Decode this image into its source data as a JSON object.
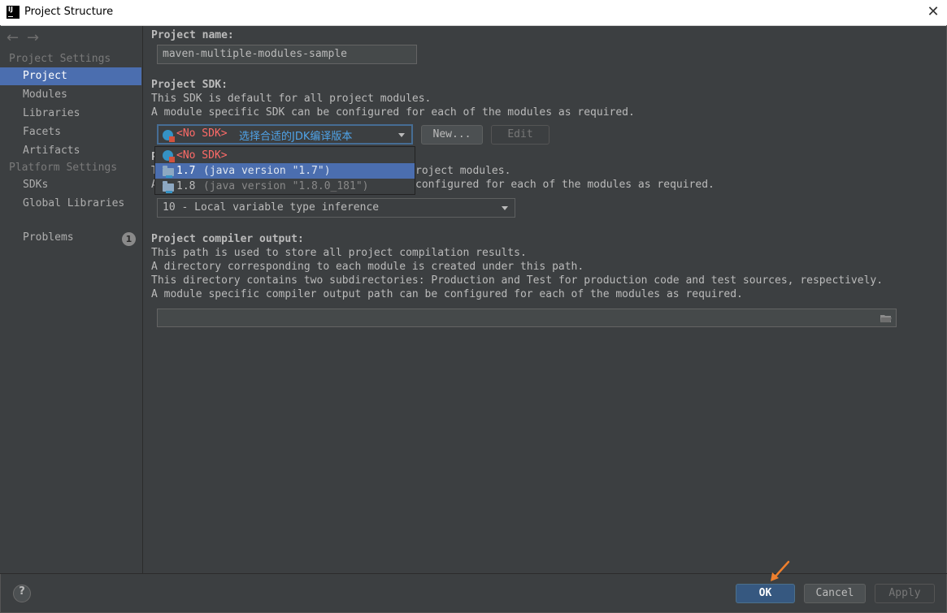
{
  "window": {
    "title": "Project Structure",
    "close_glyph": "✕"
  },
  "toolbar": {
    "back_glyph": "←",
    "forward_glyph": "→"
  },
  "sidebar": {
    "project_settings_title": "Project Settings",
    "project_items": [
      "Project",
      "Modules",
      "Libraries",
      "Facets",
      "Artifacts"
    ],
    "platform_settings_title": "Platform Settings",
    "platform_items": [
      "SDKs",
      "Global Libraries"
    ],
    "problems_label": "Problems",
    "problems_count": "1",
    "selected": "Project"
  },
  "project_name": {
    "label": "Project name:",
    "value": "maven-multiple-modules-sample"
  },
  "project_sdk": {
    "label": "Project SDK:",
    "desc1": "This SDK is default for all project modules.",
    "desc2": "A module specific SDK can be configured for each of the modules as required.",
    "selected_value": "<No SDK>",
    "annotation": "选择合适的JDK编译版本",
    "new_button": "New...",
    "edit_button": "Edit",
    "options": [
      {
        "name": "<No SDK>",
        "detail": ""
      },
      {
        "name": "1.7",
        "detail": "(java version \"1.7\")"
      },
      {
        "name": "1.8",
        "detail": "(java version \"1.8.0_181\")"
      }
    ],
    "highlighted_option": "1.7"
  },
  "project_language_level": {
    "label_partial": "P",
    "desc1_partial": "T",
    "desc1_tail": "roject modules.",
    "desc2_partial": "A",
    "desc2_tail": "configured for each of the modules as required.",
    "value": "10 - Local variable type inference"
  },
  "compiler_output": {
    "label": "Project compiler output:",
    "desc1": "This path is used to store all project compilation results.",
    "desc2": "A directory corresponding to each module is created under this path.",
    "desc3": "This directory contains two subdirectories: Production and Test for production code and test sources, respectively.",
    "desc4": "A module specific compiler output path can be configured for each of the modules as required.",
    "value": ""
  },
  "footer": {
    "help": "?",
    "ok": "OK",
    "cancel": "Cancel",
    "apply": "Apply"
  },
  "colors": {
    "accent": "#4b6eaf",
    "annotation": "#ee7f2d",
    "error_red": "#ff6b68",
    "background": "#3c3f41"
  }
}
